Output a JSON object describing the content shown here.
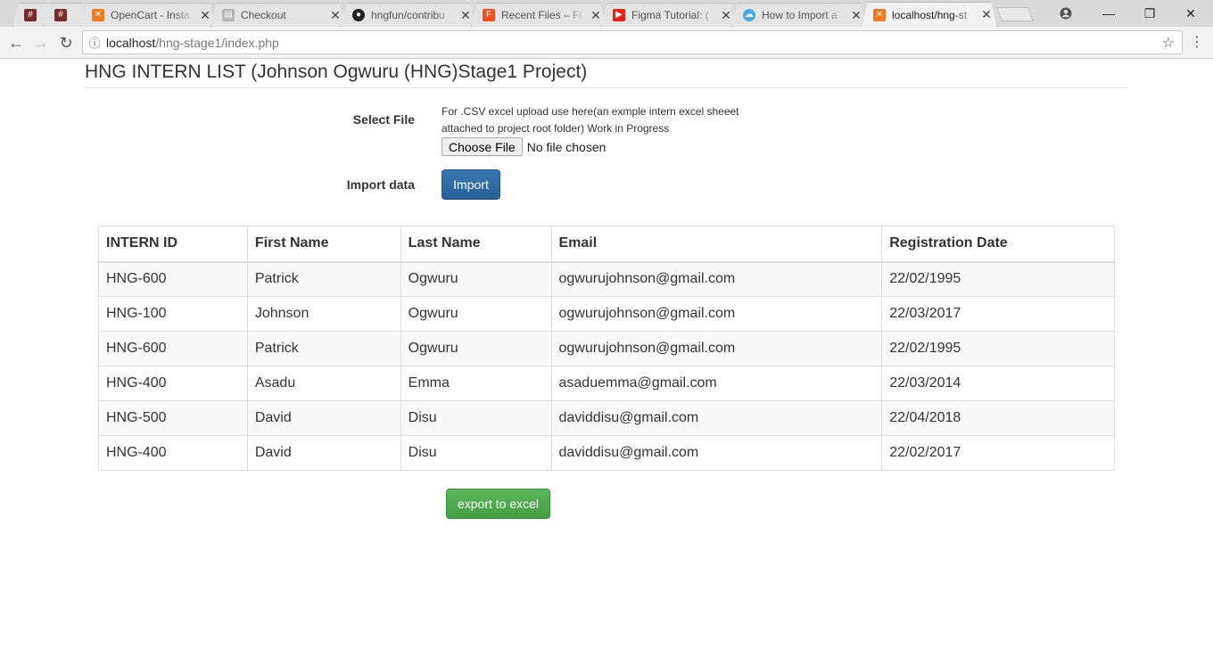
{
  "browser": {
    "tabs": [
      {
        "label": "",
        "icon": "hash-icon",
        "color": "#7a2c2c"
      },
      {
        "label": "",
        "icon": "hash-icon",
        "color": "#7a2c2c"
      },
      {
        "label": "OpenCart - Insta",
        "icon": "xampp-icon",
        "color": "#f07a22"
      },
      {
        "label": "Checkout",
        "icon": "cart-icon",
        "color": "#9a9a9a"
      },
      {
        "label": "hngfun/contribu",
        "icon": "github-icon",
        "color": "#222222"
      },
      {
        "label": "Recent Files – Fi",
        "icon": "figma-icon",
        "color": "#f24e1e"
      },
      {
        "label": "Figma Tutorial: (",
        "icon": "youtube-icon",
        "color": "#e62117"
      },
      {
        "label": "How to Import a",
        "icon": "cloud-icon",
        "color": "#4aa8e0"
      },
      {
        "label": "localhost/hng-st",
        "icon": "xampp-icon",
        "color": "#f07a22"
      }
    ],
    "url_host": "localhost",
    "url_path": "/hng-stage1/index.php"
  },
  "page": {
    "title": "HNG INTERN LIST (Johnson Ogwuru (HNG)Stage1 Project)",
    "select_file_label": "Select File",
    "upload_help": "For .CSV excel upload use here(an exmple intern excel sheeet attached to project root folder) Work in Progress",
    "choose_file_label": "Choose File",
    "no_file_text": "No file chosen",
    "import_data_label": "Import data",
    "import_button": "Import",
    "export_button": "export to excel"
  },
  "table": {
    "headers": [
      "INTERN ID",
      "First Name",
      "Last Name",
      "Email",
      "Registration Date"
    ],
    "rows": [
      [
        "HNG-600",
        "Patrick",
        "Ogwuru",
        "ogwurujohnson@gmail.com",
        "22/02/1995"
      ],
      [
        "HNG-100",
        "Johnson",
        "Ogwuru",
        "ogwurujohnson@gmail.com",
        "22/03/2017"
      ],
      [
        "HNG-600",
        "Patrick",
        "Ogwuru",
        "ogwurujohnson@gmail.com",
        "22/02/1995"
      ],
      [
        "HNG-400",
        "Asadu",
        "Emma",
        "asaduemma@gmail.com",
        "22/03/2014"
      ],
      [
        "HNG-500",
        "David",
        "Disu",
        "daviddisu@gmail.com",
        "22/04/2018"
      ],
      [
        "HNG-400",
        "David",
        "Disu",
        "daviddisu@gmail.com",
        "22/02/2017"
      ]
    ]
  }
}
